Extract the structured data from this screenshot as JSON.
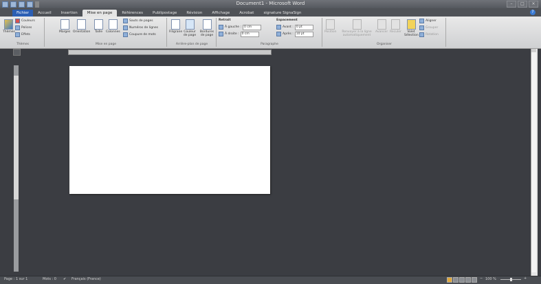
{
  "window": {
    "title": "Document1 - Microsoft Word"
  },
  "tabs": [
    "Fichier",
    "Accueil",
    "Insertion",
    "Mise en page",
    "Références",
    "Publipostage",
    "Révision",
    "Affichage",
    "Acrobat",
    "signature SignaSign"
  ],
  "ribbon": {
    "themes": {
      "label": "Thèmes",
      "themes_btn": "Thèmes",
      "colors": "Couleurs",
      "fonts": "Polices",
      "effects": "Effets"
    },
    "page_setup": {
      "label": "Mise en page",
      "margins": "Marges",
      "orientation": "Orientation",
      "size": "Taille",
      "columns": "Colonnes",
      "breaks": "Sauts de pages",
      "line_numbers": "Numéros de lignes",
      "hyphenation": "Coupure de mots"
    },
    "page_background": {
      "label": "Arrière-plan de page",
      "watermark": "Filigrane",
      "page_color": "Couleur de page",
      "page_borders": "Bordures de page"
    },
    "paragraph": {
      "label": "Paragraphe",
      "indent": "Retrait",
      "left": "À gauche :",
      "right": "À droite :",
      "left_val": "0 cm",
      "right_val": "0 cm",
      "spacing": "Espacement",
      "before": "Avant :",
      "after": "Après :",
      "before_val": "0 pt",
      "after_val": "10 pt"
    },
    "arrange": {
      "label": "Organiser",
      "position": "Position",
      "wrap_text": "Renvoyer à la ligne automatiquement",
      "bring_forward": "Avancer",
      "send_backward": "Reculer",
      "selection_pane": "Volet Sélection",
      "align": "Aligner",
      "group": "Grouper",
      "rotate": "Rotation"
    }
  },
  "statusbar": {
    "page": "Page : 1 sur 1",
    "words": "Mots : 0",
    "language": "Français (France)",
    "zoom": "100 %"
  }
}
